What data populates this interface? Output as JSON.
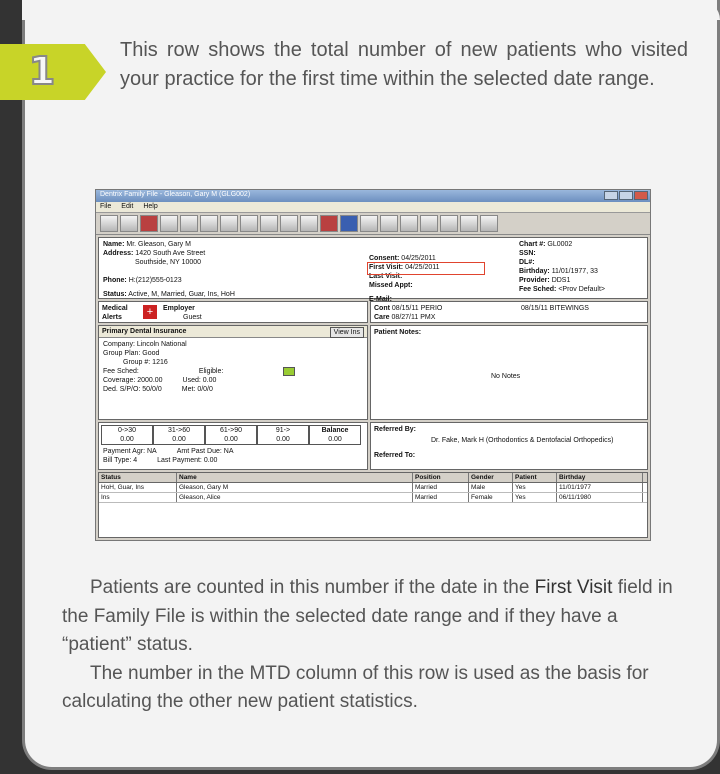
{
  "step": {
    "number": "1"
  },
  "intro": "This row shows the total number of new patients who visited your practice for the first time within the selected date range.",
  "screenshot": {
    "title": "Dentrix Family File - Gleason, Gary M (GLG002)",
    "menu": [
      "File",
      "Edit",
      "Help"
    ],
    "patient": {
      "name_label": "Name:",
      "name_value": "Mr. Gleason, Gary M",
      "address_label": "Address:",
      "address_value": "1420 South Ave Street",
      "city_value": "Southside, NY 10000",
      "phone_label": "Phone:",
      "phone_value": "H:(212)555-0123",
      "status_label": "Status:",
      "status_value": "Active, M, Married, Guar, Ins, HoH",
      "consent_label": "Consent:",
      "consent_value": "04/25/2011",
      "first_visit_label": "First Visit:",
      "first_visit_value": "04/25/2011",
      "last_visit_label": "Last Visit:",
      "missed_label": "Missed Appt:",
      "email_label": "E-Mail:",
      "chart_label": "Chart #:",
      "chart_value": "GL0002",
      "ssn_label": "SSN:",
      "dl_label": "DL#:",
      "birthday_label": "Birthday:",
      "birthday_value": "11/01/1977, 33",
      "provider_label": "Provider:",
      "provider_value": "DDS1",
      "fee_label": "Fee Sched:",
      "fee_value": "<Prov Default>"
    },
    "alerts": {
      "medical_label": "Medical Alerts",
      "employer_label": "Employer",
      "employer_value": "Guest"
    },
    "recalls": {
      "label1": "Cont",
      "value1": "08/15/11 PERIO",
      "label2": "Care",
      "value2": "08/27/11 PMX",
      "extra": "08/15/11 BITEWINGS"
    },
    "insurance": {
      "title": "Primary Dental Insurance",
      "view_button": "View Ins",
      "company": "Company: Lincoln National",
      "group_plan": "Group Plan: Good",
      "group_num": "Group #: 1216",
      "fee_sched": "Fee Sched:",
      "eligible": "Eligible:",
      "coverage": "Coverage: 2000.00",
      "used": "Used: 0.00",
      "ded": "Ded. S/P/O: 50/0/0",
      "met": "Met: 0/0/0"
    },
    "notes": {
      "title": "Patient Notes:",
      "body": "No Notes"
    },
    "aging": {
      "headers": [
        "0->30",
        "31->60",
        "61->90",
        "91->",
        "Balance"
      ],
      "values": [
        "0.00",
        "0.00",
        "0.00",
        "0.00",
        "0.00"
      ],
      "payment_label": "Payment Agr: NA",
      "amt_due": "Amt Past Due: NA",
      "bill_type": "Bill Type: 4",
      "last_payment": "Last Payment: 0.00"
    },
    "referred": {
      "by_label": "Referred By:",
      "by_value": "Dr. Fake, Mark H (Orthodontics & Dentofacial Orthopedics)",
      "to_label": "Referred To:"
    },
    "family": {
      "headers": [
        "Status",
        "Name",
        "Position",
        "Gender",
        "Patient",
        "Birthday"
      ],
      "rows": [
        [
          "HoH, Guar, Ins",
          "Gleason, Gary M",
          "Married",
          "Male",
          "Yes",
          "11/01/1977"
        ],
        [
          "Ins",
          "Gleason, Alice",
          "Married",
          "Female",
          "Yes",
          "06/11/1980"
        ]
      ]
    }
  },
  "body": {
    "p1_before": "Patients are counted in this number if the date in the ",
    "p1_term": "First Visit",
    "p1_after": " field in the Family File is within the selected date range and if they have a “patient” status.",
    "p2": "The number in the MTD column of this row is used as the basis for calculating the other new patient statistics."
  }
}
